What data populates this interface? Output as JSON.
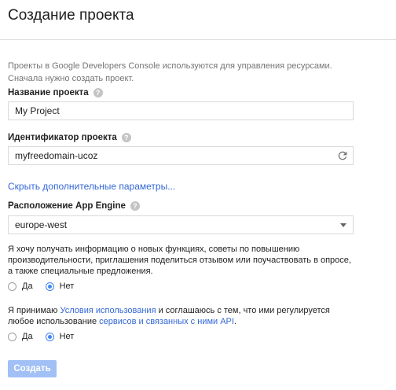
{
  "dialog": {
    "title": "Создание проекта",
    "intro_line1": "Проекты в Google Developers Console используются для управления ресурсами.",
    "intro_line2": "Сначала нужно создать проект."
  },
  "project_name": {
    "label": "Название проекта",
    "value": "My Project",
    "help_icon": "question-icon"
  },
  "project_id": {
    "label": "Идентификатор проекта",
    "value": "myfreedomain-ucoz",
    "help_icon": "question-icon",
    "refresh_icon": "refresh-icon"
  },
  "advanced_link": "Скрыть дополнительные параметры...",
  "app_engine": {
    "label": "Расположение App Engine",
    "selected": "europe-west",
    "help_icon": "question-icon"
  },
  "newsletter": {
    "text": "Я хочу получать информацию о новых функциях, советы по повышению производительности, приглашения поделиться отзывом или поучаствовать в опросе, а также специальные предложения.",
    "options": [
      "Да",
      "Нет"
    ],
    "selected": "Нет"
  },
  "terms": {
    "text_before": "Я принимаю ",
    "link1": "Условия использования",
    "text_middle": " и соглашаюсь с тем, что ими регулируется любое использование ",
    "link2": "сервисов и связанных с ними API",
    "text_after": ".",
    "options": [
      "Да",
      "Нет"
    ],
    "selected": "Нет"
  },
  "create_button": "Создать",
  "colors": {
    "accent": "#4285f4",
    "link": "#3367d6",
    "button_disabled": "#a1c0f5"
  }
}
